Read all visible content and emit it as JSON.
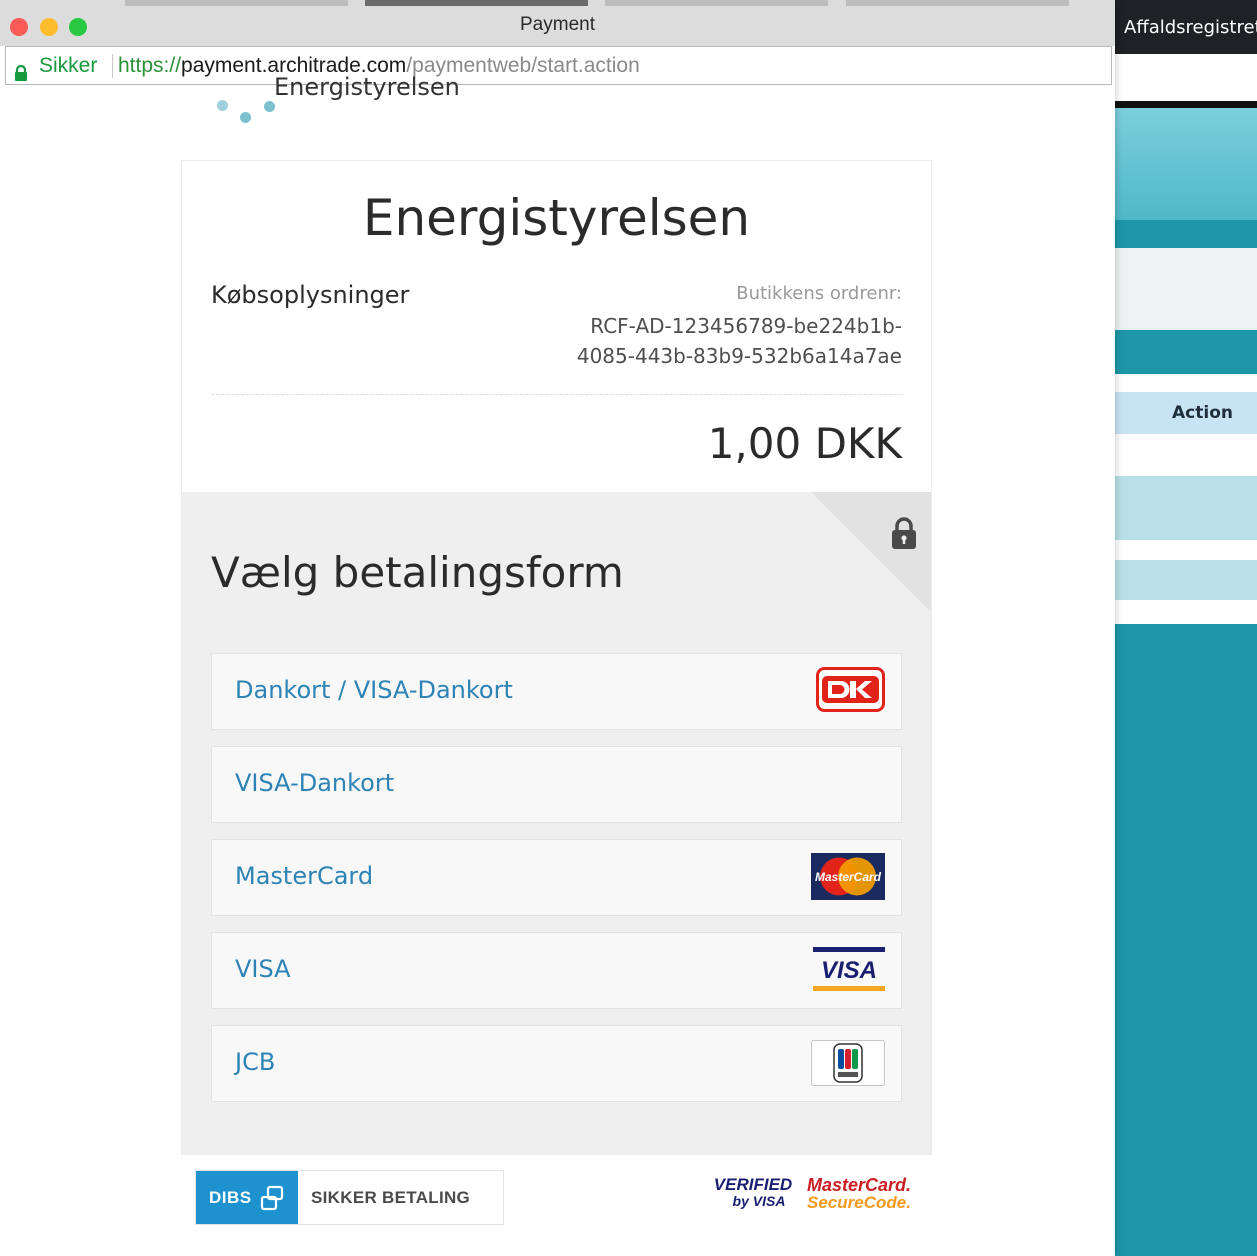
{
  "window": {
    "title": "Payment"
  },
  "address_bar": {
    "secure_label": "Sikker",
    "url_scheme": "https://",
    "url_host": "payment.architrade.com",
    "url_path": "/paymentweb/start.action"
  },
  "background_app": {
    "title": "Affaldsregistret",
    "column_header": "Action",
    "colors": {
      "teal": "#1d97a8",
      "light_band": "#b9e0e6",
      "header_band": "#c8e3f4"
    }
  },
  "logo": {
    "name": "Energistyrelsen"
  },
  "order": {
    "shop_name": "Energistyrelsen",
    "section_label": "Købsoplysninger",
    "order_number_label": "Butikkens ordrenr:",
    "order_number": "RCF-AD-123456789-be224b1b-4085-443b-83b9-532b6a14a7ae",
    "amount": "1,00 DKK"
  },
  "payment": {
    "heading": "Vælg betalingsform",
    "methods": [
      {
        "label": "Dankort / VISA-Dankort",
        "logo_icon": "dankort-logo"
      },
      {
        "label": "VISA-Dankort",
        "logo_icon": ""
      },
      {
        "label": "MasterCard",
        "logo_icon": "mastercard-logo"
      },
      {
        "label": "VISA",
        "logo_icon": "visa-logo"
      },
      {
        "label": "JCB",
        "logo_icon": "jcb-logo"
      }
    ],
    "link_color": "#2d83b5"
  },
  "footer": {
    "dibs_brand": "DIBS",
    "dibs_text": "SIKKER BETALING",
    "verified_line1": "VERIFIED",
    "verified_line2": "by VISA",
    "mc_line1": "MasterCard.",
    "mc_line2": "SecureCode."
  }
}
